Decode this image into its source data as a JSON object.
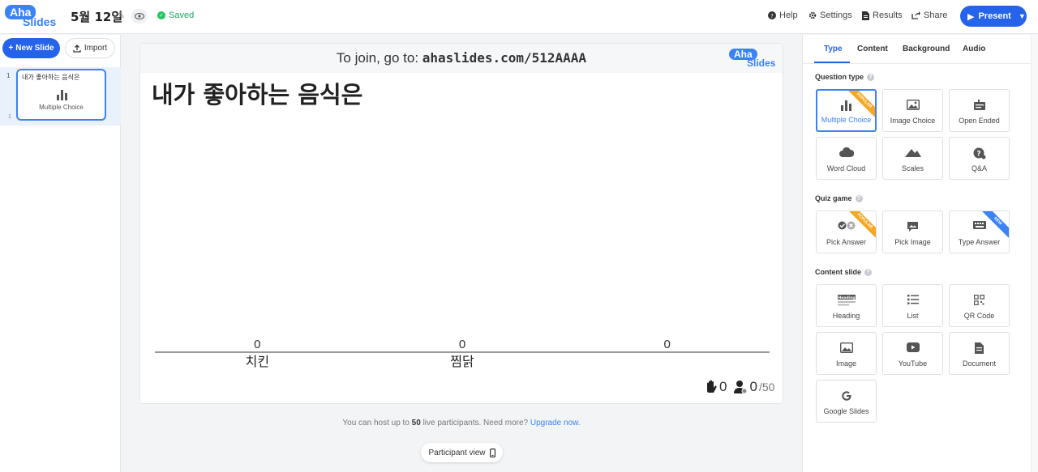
{
  "header": {
    "logo_top": "Aha",
    "logo_bottom": "Slides",
    "title": "5월 12일",
    "saved": "Saved",
    "help": "Help",
    "settings": "Settings",
    "results": "Results",
    "share": "Share",
    "present": "Present"
  },
  "left": {
    "new_slide": "New Slide",
    "import": "Import",
    "slide": {
      "number": "1",
      "count": "1",
      "title": "내가 좋아하는 음식은",
      "type": "Multiple Choice"
    }
  },
  "canvas": {
    "join_prefix": "To join, go to: ",
    "join_url": "ahaslides.com/512AAAA",
    "logo_top": "Aha",
    "logo_bottom": "Slides",
    "question": "내가 좋아하는 음식은",
    "hands": "0",
    "participants": "0",
    "limit": "/50"
  },
  "chart_data": {
    "type": "bar",
    "categories": [
      "치킨",
      "찜닭",
      ""
    ],
    "values": [
      0,
      0,
      0
    ]
  },
  "footer": {
    "note_prefix": "You can host up to ",
    "note_count": "50",
    "note_mid": " live participants. Need more? ",
    "note_link": "Upgrade now.",
    "participant_view": "Participant view"
  },
  "right": {
    "tabs": [
      "Type",
      "Content",
      "Background",
      "Audio"
    ],
    "question_type_label": "Question type",
    "quiz_game_label": "Quiz game",
    "content_slide_label": "Content slide",
    "question_types": [
      "Multiple Choice",
      "Image Choice",
      "Open Ended",
      "Word Cloud",
      "Scales",
      "Q&A"
    ],
    "quiz_types": [
      "Pick Answer",
      "Pick Image",
      "Type Answer"
    ],
    "content_types": [
      "Heading",
      "List",
      "QR Code",
      "Image",
      "YouTube",
      "Document",
      "Google Slides"
    ],
    "ribbon_popular": "POPULAR",
    "ribbon_new": "NEW",
    "heading_icon_text": "Heading"
  },
  "colors": {
    "accent": "#2563eb",
    "saved": "#22c55e",
    "popular": "#f5a623"
  }
}
